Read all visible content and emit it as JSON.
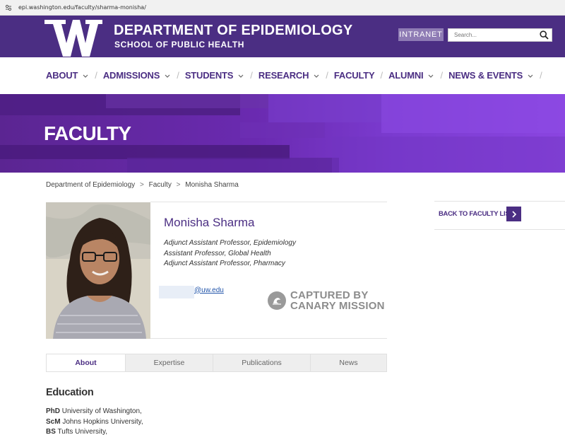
{
  "browser": {
    "url": "epi.washington.edu/faculty/sharma-monisha/"
  },
  "header": {
    "logo_letter": "W",
    "title": "DEPARTMENT OF EPIDEMIOLOGY",
    "subtitle": "SCHOOL OF PUBLIC HEALTH",
    "intranet_label": "INTRANET",
    "search_placeholder": "Search...",
    "brand_color": "#4b2e83"
  },
  "nav": {
    "items": [
      {
        "label": "ABOUT",
        "has_dropdown": true
      },
      {
        "label": "ADMISSIONS",
        "has_dropdown": true
      },
      {
        "label": "STUDENTS",
        "has_dropdown": true
      },
      {
        "label": "RESEARCH",
        "has_dropdown": true
      },
      {
        "label": "FACULTY",
        "has_dropdown": false
      },
      {
        "label": "ALUMNI",
        "has_dropdown": true
      },
      {
        "label": "NEWS & EVENTS",
        "has_dropdown": true
      }
    ]
  },
  "hero": {
    "title": "FACULTY"
  },
  "breadcrumb": {
    "items": [
      "Department of Epidemiology",
      "Faculty",
      "Monisha Sharma"
    ],
    "separator": ">"
  },
  "profile": {
    "name": "Monisha Sharma",
    "titles": [
      "Adjunct Assistant Professor, Epidemiology",
      "Assistant Professor, Global Health",
      "Adjunct Assistant Professor, Pharmacy"
    ],
    "email_domain": "@uw.edu",
    "back_label": "BACK TO FACULTY LIST"
  },
  "watermark": {
    "line1": "CAPTURED BY",
    "line2": "CANARY MISSION"
  },
  "tabs": [
    {
      "label": "About",
      "active": true
    },
    {
      "label": "Expertise",
      "active": false
    },
    {
      "label": "Publications",
      "active": false
    },
    {
      "label": "News",
      "active": false
    }
  ],
  "education": {
    "heading": "Education",
    "entries": [
      {
        "degree": "PhD",
        "institution": "University of Washington,"
      },
      {
        "degree": "ScM",
        "institution": "Johns Hopkins University,"
      },
      {
        "degree": "BS",
        "institution": "Tufts University,"
      }
    ]
  }
}
